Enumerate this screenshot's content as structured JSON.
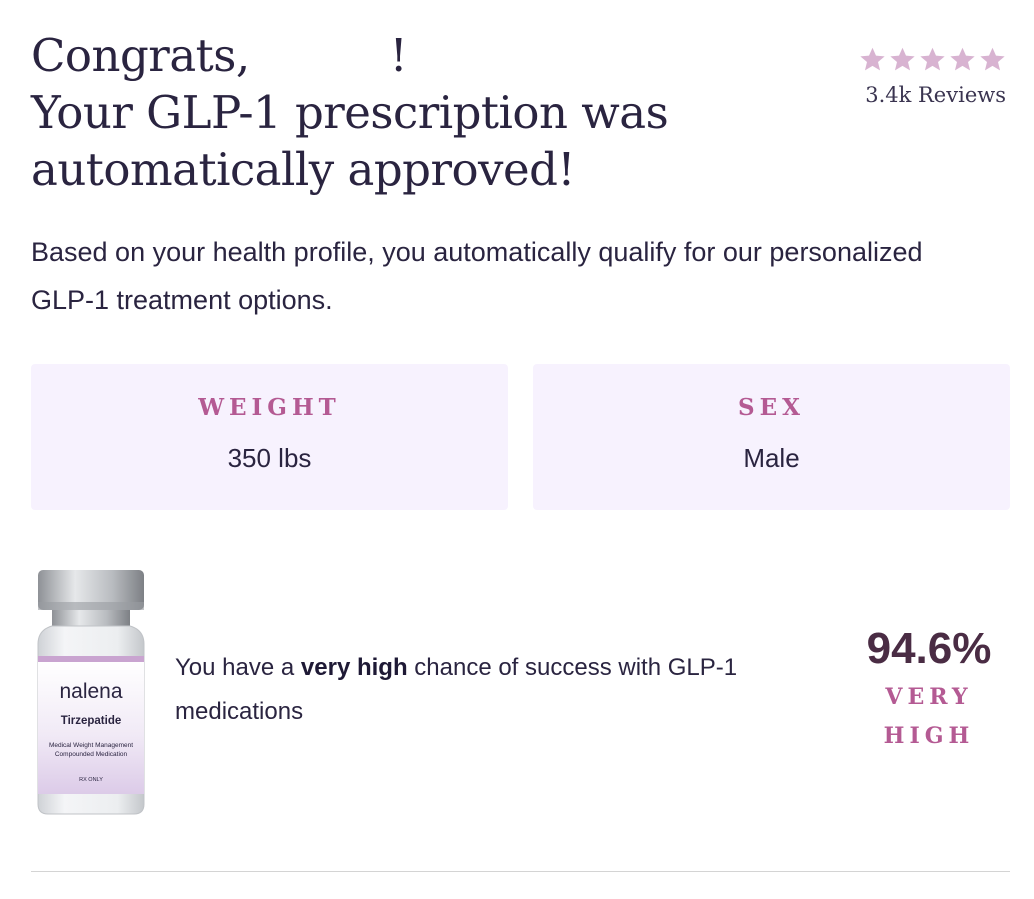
{
  "header": {
    "greeting": "Congrats,",
    "greeting_end": "!",
    "title_line2": "Your GLP-1 prescription was",
    "title_line3": "automatically approved!"
  },
  "rating": {
    "stars": 5,
    "star_color": "#d8b3d1",
    "reviews": "3.4k Reviews"
  },
  "subtext": "Based on your health profile, you automatically qualify for our personalized GLP-1 treatment options.",
  "stats": {
    "weight_label": "WEIGHT",
    "weight_value": "350 lbs",
    "sex_label": "SEX",
    "sex_value": "Male"
  },
  "product": {
    "brand": "nalena",
    "name": "Tirzepatide",
    "desc_line1": "Medical Weight Management",
    "desc_line2": "Compounded Medication",
    "rx": "RX ONLY"
  },
  "success": {
    "prefix": "You have a ",
    "emphasis": "very high",
    "suffix": " chance of success with GLP-1 medications",
    "percent": "94.6%",
    "level_line1": "VERY",
    "level_line2": "HIGH"
  },
  "colors": {
    "accent": "#b45a93",
    "text": "#2a2440",
    "card_bg": "#f7f2fe"
  }
}
